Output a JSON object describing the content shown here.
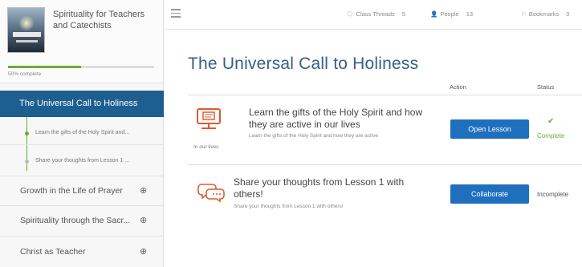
{
  "course": {
    "title": "Spirituality for Teachers and Catechists",
    "progress_text": "50% complete",
    "progress_fraction": 0.5
  },
  "sidebar": {
    "active_module": "The Universal Call to Holiness",
    "lessons": [
      {
        "label": "Learn the gifts of the Holy Spirit and..."
      },
      {
        "label": "Share your thoughts from Lesson 1 ..."
      }
    ],
    "modules": [
      {
        "label": "Growth in the Life of Prayer"
      },
      {
        "label": "Spirituality through the Sacr..."
      },
      {
        "label": "Christ as Teacher"
      }
    ]
  },
  "topbar": {
    "threads_label": "Class Threads",
    "threads_count": "5",
    "people_label": "People",
    "people_count": "13",
    "bookmarks_label": "Bookmarks",
    "bookmarks_count": "0"
  },
  "main": {
    "title": "The Universal Call to Holiness",
    "columns": {
      "action": "Action",
      "status": "Status"
    },
    "rows": [
      {
        "icon": "lesson-screen-icon",
        "under_icon_label": "In our lives",
        "title": "Learn the gifts of the Holy Spirit and how they are active in our lives",
        "subtitle": "Learn the gifts of the Holy Spirit and how they are active",
        "button": "Open Lesson",
        "status": "Complete",
        "status_color": "#6aab3a"
      },
      {
        "icon": "discussion-bubbles-icon",
        "title": "Share your thoughts from Lesson 1 with others!",
        "subtitle": "Share your thoughts from Lesson 1 with others!",
        "button": "Collaborate",
        "status": "Incomplete"
      }
    ]
  },
  "colors": {
    "accent": "#1e5f91",
    "button": "#1f6fbf",
    "progress": "#6cab3a",
    "title": "#345f8a"
  }
}
